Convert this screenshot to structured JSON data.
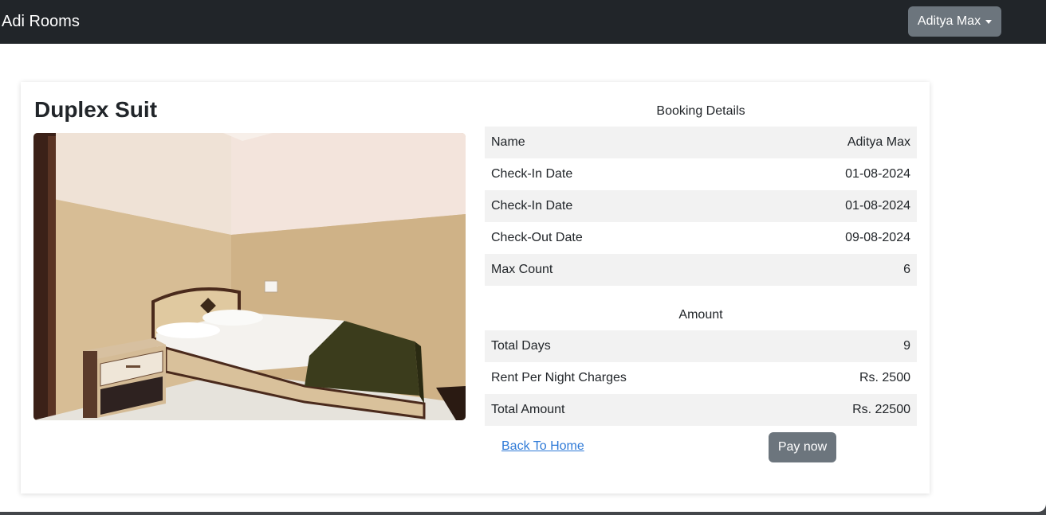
{
  "navbar": {
    "brand": "Adi Rooms",
    "user_menu_label": "Aditya Max"
  },
  "room": {
    "title": "Duplex Suit"
  },
  "booking": {
    "heading": "Booking Details",
    "rows": [
      {
        "label": "Name",
        "value": "Aditya Max"
      },
      {
        "label": "Check-In Date",
        "value": "01-08-2024"
      },
      {
        "label": "Check-In Date",
        "value": "01-08-2024"
      },
      {
        "label": "Check-Out Date",
        "value": "09-08-2024"
      },
      {
        "label": "Max Count",
        "value": "6"
      }
    ]
  },
  "amount": {
    "heading": "Amount",
    "rows": [
      {
        "label": "Total Days",
        "value": "9"
      },
      {
        "label": "Rent Per Night Charges",
        "value": "Rs. 2500"
      },
      {
        "label": "Total Amount",
        "value": "Rs. 22500"
      }
    ]
  },
  "actions": {
    "back_label": "Back To Home",
    "pay_label": "Pay now"
  },
  "colors": {
    "navbar": "#212529",
    "secondary_button": "#6c757d",
    "link": "#2f7ad7",
    "row_shade": "#f2f2f2"
  }
}
